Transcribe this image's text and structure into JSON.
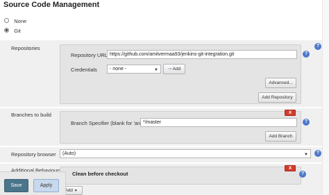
{
  "section": {
    "title": "Source Code Management"
  },
  "scm_options": [
    {
      "label": "None",
      "selected": false
    },
    {
      "label": "Git",
      "selected": true
    }
  ],
  "repositories": {
    "label": "Repositories",
    "url_label": "Repository URL",
    "url_value": "https://github.com/amitvermaa93/jenkins-git-integration.git",
    "credentials_label": "Credentials",
    "credentials_value": "- none -",
    "add_label": "Add",
    "advanced_label": "Advanced...",
    "add_repository_label": "Add Repository"
  },
  "branches": {
    "label": "Branches to build",
    "delete_label": "X",
    "specifier_label": "Branch Specifier (blank for 'any')",
    "specifier_value": "*/master",
    "add_branch_label": "Add Branch"
  },
  "browser": {
    "label": "Repository browser",
    "value": "(Auto)"
  },
  "behaviours": {
    "label": "Additional Behaviours",
    "item_title": "Clean before checkout",
    "delete_label": "X",
    "add_label": "Add"
  },
  "help_label": "?",
  "actions": {
    "save_label": "Save",
    "apply_label": "Apply"
  },
  "colors": {
    "help_icon": "#4c78c9",
    "delete_button": "#d33a2c",
    "save_button": "#4b758b",
    "apply_button": "#c8d9ec"
  }
}
